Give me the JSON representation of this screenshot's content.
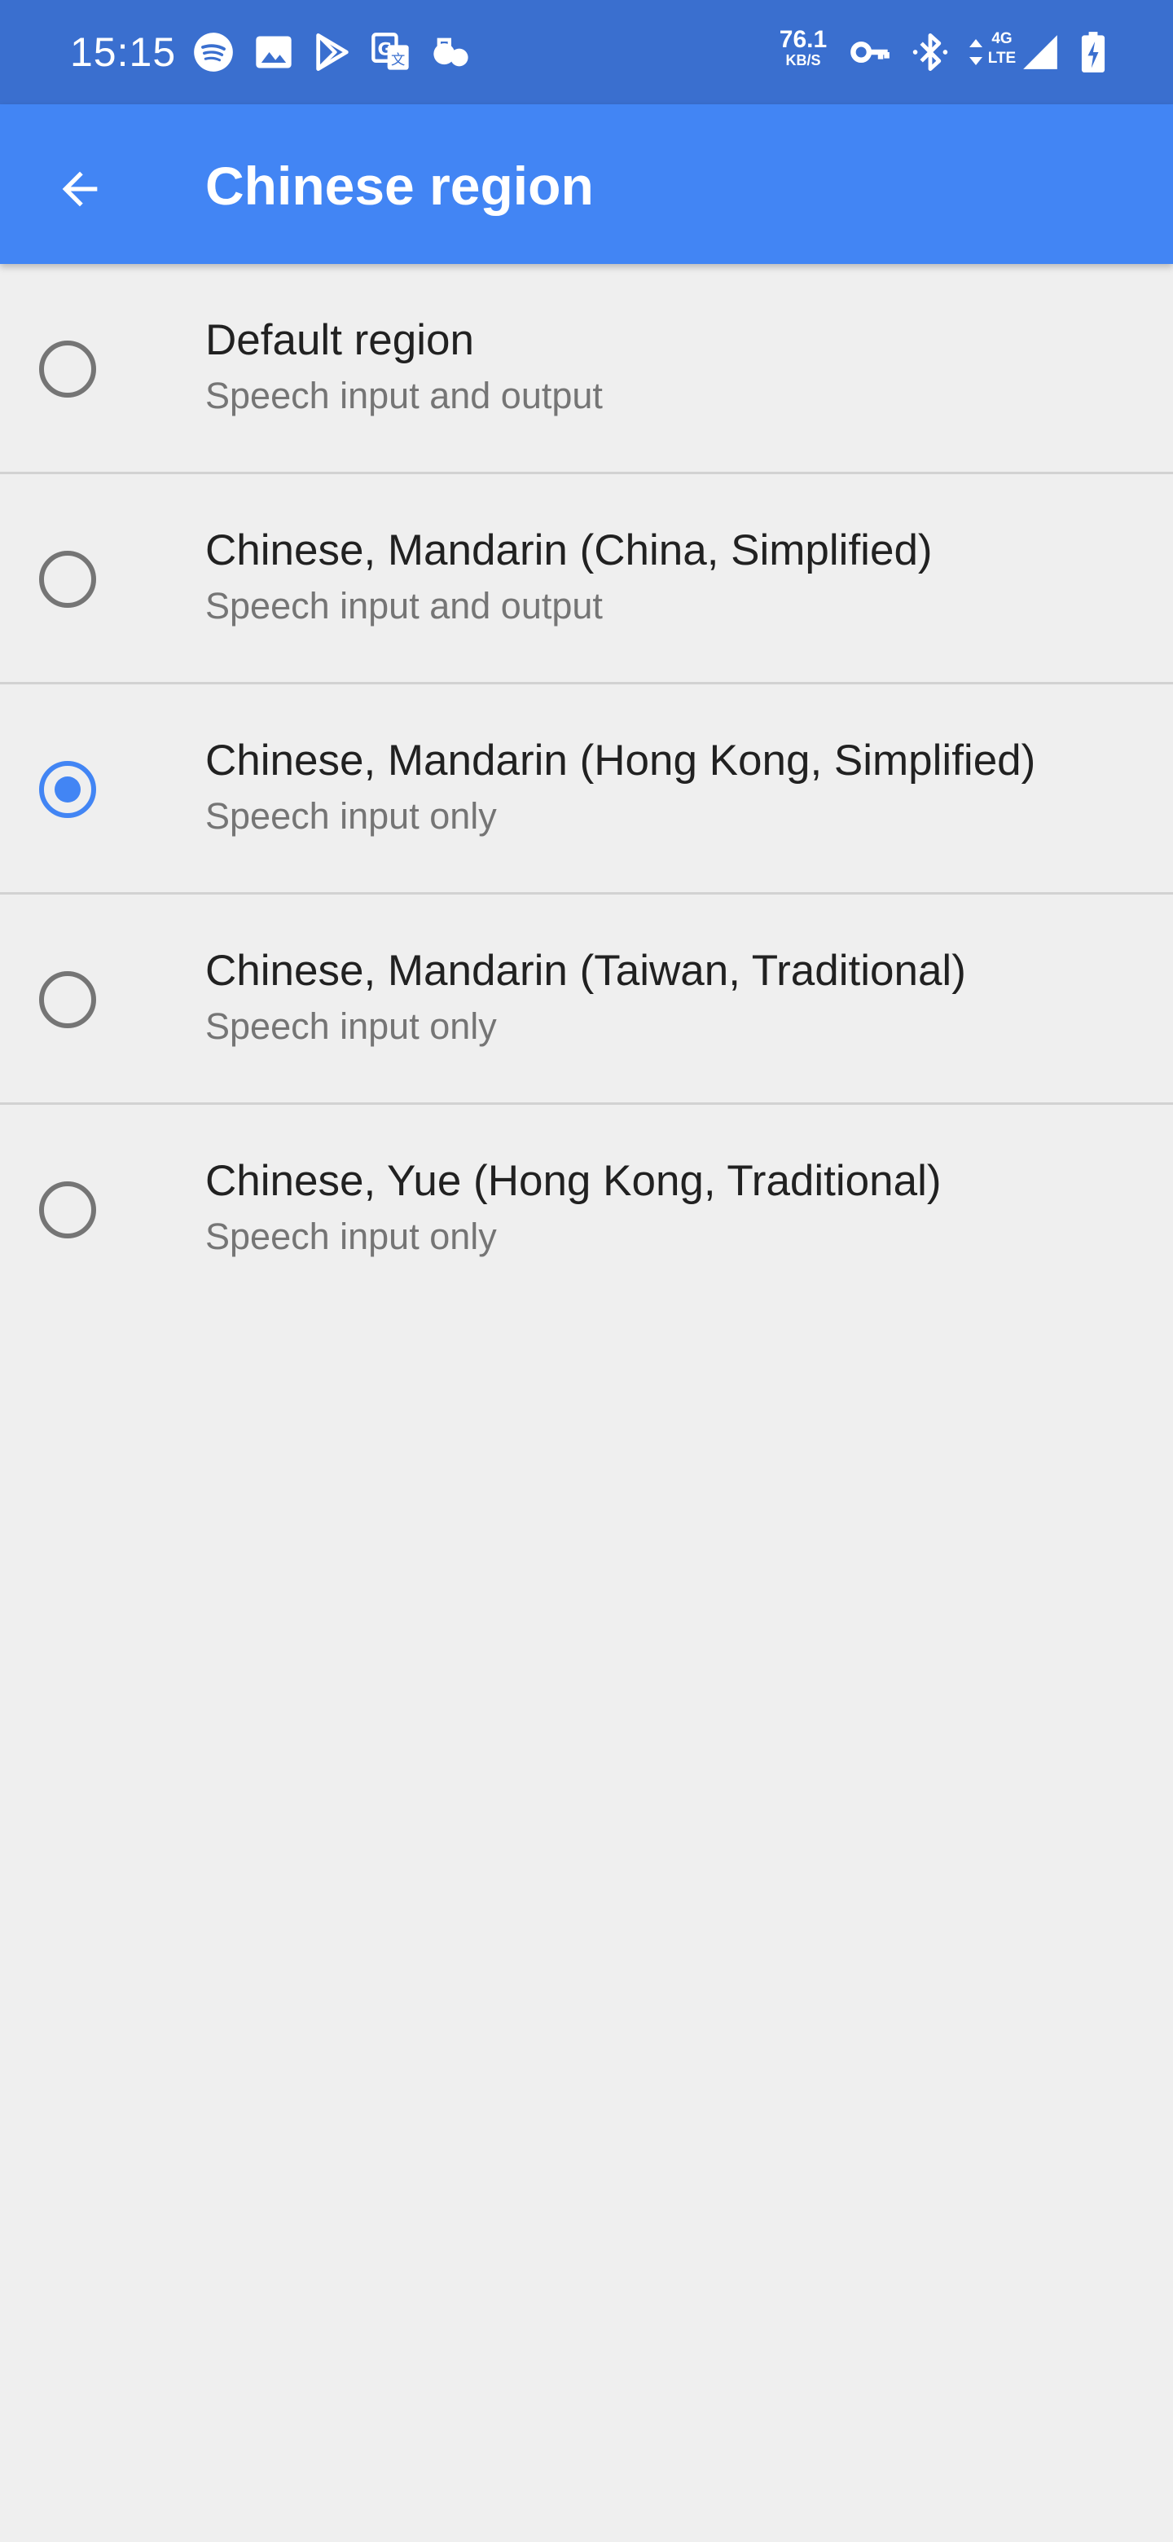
{
  "status_bar": {
    "time": "15:15",
    "net_speed": "76.1",
    "net_speed_unit": "KB/S",
    "net_type_top": "4G",
    "net_type_bottom": "LTE",
    "notification_icons": [
      "spotify-icon",
      "image-icon",
      "play-store-icon",
      "translate-icon",
      "wellbeing-icon"
    ],
    "system_icons": [
      "vpn-key-icon",
      "bluetooth-icon",
      "data-arrows-icon",
      "signal-icon",
      "battery-charging-icon"
    ]
  },
  "app_bar": {
    "title": "Chinese region",
    "back_icon": "arrow-back-icon",
    "color": "#4285f4"
  },
  "regions": {
    "selected_index": 2,
    "items": [
      {
        "title": "Default region",
        "subtitle": "Speech input and output",
        "checked": false
      },
      {
        "title": "Chinese, Mandarin (China, Simplified)",
        "subtitle": "Speech input and output",
        "checked": false
      },
      {
        "title": "Chinese, Mandarin (Hong Kong, Simplified)",
        "subtitle": "Speech input only",
        "checked": true
      },
      {
        "title": "Chinese, Mandarin (Taiwan, Traditional)",
        "subtitle": "Speech input only",
        "checked": false
      },
      {
        "title": "Chinese, Yue (Hong Kong, Traditional)",
        "subtitle": "Speech input only",
        "checked": false
      }
    ]
  },
  "colors": {
    "status_bar": "#3a6fcf",
    "accent": "#4285f4",
    "background": "#efefef",
    "radio_unchecked": "#757575"
  }
}
